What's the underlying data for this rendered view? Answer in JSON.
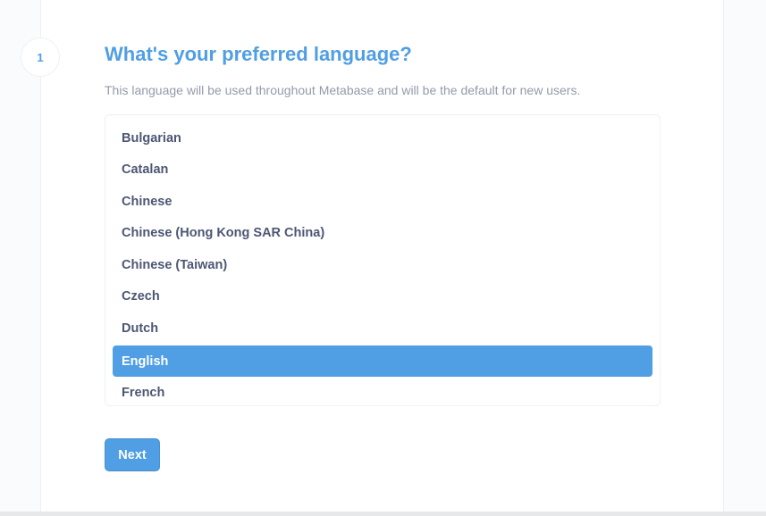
{
  "step": {
    "number": "1",
    "title": "What's your preferred language?",
    "description": "This language will be used throughout Metabase and will be the default for new users."
  },
  "languages": [
    {
      "label": "Bulgarian",
      "selected": false
    },
    {
      "label": "Catalan",
      "selected": false
    },
    {
      "label": "Chinese",
      "selected": false
    },
    {
      "label": "Chinese (Hong Kong SAR China)",
      "selected": false
    },
    {
      "label": "Chinese (Taiwan)",
      "selected": false
    },
    {
      "label": "Czech",
      "selected": false
    },
    {
      "label": "Dutch",
      "selected": false
    },
    {
      "label": "English",
      "selected": true
    },
    {
      "label": "French",
      "selected": false
    }
  ],
  "actions": {
    "next_label": "Next"
  },
  "colors": {
    "accent": "#509ee3",
    "text_dark": "#4c5773",
    "text_muted": "#949aab"
  }
}
